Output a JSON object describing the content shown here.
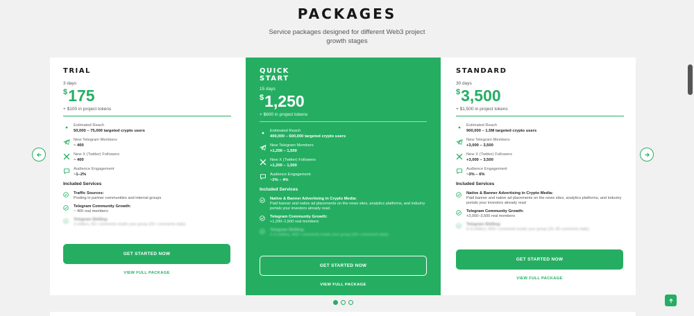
{
  "header": {
    "title": "PACKAGES",
    "subtitle": "Service packages designed for different Web3 project growth stages"
  },
  "colors": {
    "accent": "#25ae62",
    "background": "#f1f1f1",
    "card": "#ffffff"
  },
  "plans": [
    {
      "name": "TRIAL",
      "days": "3 days",
      "currency": "$",
      "price": "175",
      "tokens": "+ $100 in project tokens",
      "metrics": [
        {
          "icon": "eye-icon",
          "label": "Estimated Reach",
          "value": "50,000 – 75,000 targeted crypto users"
        },
        {
          "icon": "telegram-icon",
          "label": "New Telegram Members",
          "value": "~ 400"
        },
        {
          "icon": "x-twitter-icon",
          "label": "New X (Twitter) Followers",
          "value": "~ 400"
        },
        {
          "icon": "chat-icon",
          "label": "Audience Engagement",
          "value": "~1–2%"
        }
      ],
      "included_title": "Included Services",
      "services": [
        {
          "title": "Traffic Sources:",
          "desc": "Posting in partner communities and internal groups",
          "blurred": false
        },
        {
          "title": "Telegram Community Growth:",
          "desc": "~ 400 real members",
          "blurred": false
        },
        {
          "title": "Telegram Shilling:",
          "desc": "3 shillers, 60+ comments inside your group (20+ comments daily)",
          "blurred": true
        }
      ],
      "cta": "GET STARTED NOW",
      "view": "VIEW FULL PACKAGE"
    },
    {
      "name": "QUICK START",
      "days": "15 days",
      "currency": "$",
      "price": "1,250",
      "tokens": "+ $600 in project tokens",
      "metrics": [
        {
          "icon": "eye-icon",
          "label": "Estimated Reach",
          "value": "400,000 – 600,000 targeted crypto users"
        },
        {
          "icon": "telegram-icon",
          "label": "New Telegram Members",
          "value": "+1,200 – 1,500"
        },
        {
          "icon": "x-twitter-icon",
          "label": "New X (Twitter) Followers",
          "value": "+1,200 – 1,500"
        },
        {
          "icon": "chat-icon",
          "label": "Audience Engagement",
          "value": "~2% – 4%"
        }
      ],
      "included_title": "Included Services",
      "services": [
        {
          "title": "Native & Banner Advertising in Crypto Media:",
          "desc": "Paid banner and native ad placements on the news sites, analytics platforms, and industry portals your investors already read.",
          "blurred": false
        },
        {
          "title": "Telegram Community Growth:",
          "desc": "+1,200–1,500 real members",
          "blurred": false
        },
        {
          "title": "Telegram Shilling:",
          "desc": "3–5 shillers, 400+ comments inside your group (30+ comments daily)",
          "blurred": true
        }
      ],
      "cta": "GET STARTED NOW",
      "view": "VIEW FULL PACKAGE"
    },
    {
      "name": "STANDARD",
      "days": "30 days",
      "currency": "$",
      "price": "3,500",
      "tokens": "+ $1,500 in project tokens",
      "metrics": [
        {
          "icon": "eye-icon",
          "label": "Estimated Reach",
          "value": "900,000 – 1.5M targeted crypto users"
        },
        {
          "icon": "telegram-icon",
          "label": "New Telegram Members",
          "value": "+3,000 – 3,500"
        },
        {
          "icon": "x-twitter-icon",
          "label": "New X (Twitter) Followers",
          "value": "+3,000 – 3,500"
        },
        {
          "icon": "chat-icon",
          "label": "Audience Engagement",
          "value": "~3% – 6%"
        }
      ],
      "included_title": "Included Services",
      "services": [
        {
          "title": "Native & Banner Advertising in Crypto Media:",
          "desc": "Paid banner and native ad placements on the news sites, analytics platforms, and industry portals your investors already read",
          "blurred": false
        },
        {
          "title": "Telegram Community Growth:",
          "desc": "+3,000–3,500 real members",
          "blurred": false
        },
        {
          "title": "Telegram Shilling:",
          "desc": "5–8 shillers, 900+ comments inside your group (25–30 comments daily)",
          "blurred": true
        }
      ],
      "cta": "GET STARTED NOW",
      "view": "VIEW FULL PACKAGE"
    }
  ],
  "carousel": {
    "dots": 3,
    "active": 0
  }
}
